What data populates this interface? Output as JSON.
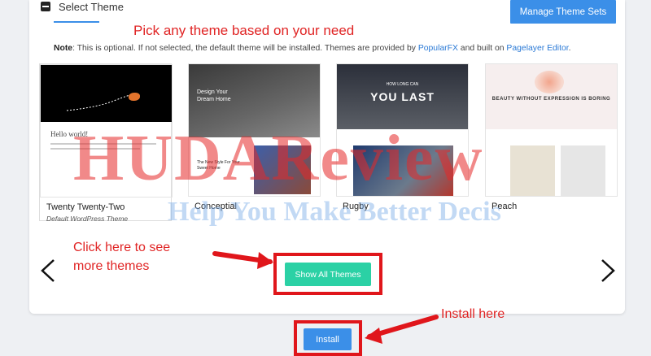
{
  "section": {
    "title": "Select Theme",
    "manage_button": "Manage Theme Sets"
  },
  "annotations": {
    "top": "Pick any theme based on your need",
    "more_line1": "Click here to see",
    "more_line2": "more themes",
    "install": "Install here"
  },
  "note": {
    "label": "Note",
    "text_before": ": This is optional. If not selected, the default theme will be installed. Themes are provided by ",
    "link1": "PopularFX",
    "text_middle": " and built on ",
    "link2": "Pagelayer Editor",
    "text_after": "."
  },
  "themes": [
    {
      "name": "Twenty Twenty-Two",
      "subtitle": "Default WordPress Theme"
    },
    {
      "name": "Conceptial",
      "subtitle": ""
    },
    {
      "name": "Rugby",
      "subtitle": ""
    },
    {
      "name": "Peach",
      "subtitle": ""
    }
  ],
  "thumbs": {
    "t1_hello": "Hello world!",
    "t2_title": "Design Your Dream Home",
    "t2_sub": "The New Style For Your Sweet Home",
    "t3_small": "HOW LONG CAN",
    "t3_big": "YOU LAST",
    "t4_text": "BEAUTY WITHOUT EXPRESSION IS BORING"
  },
  "buttons": {
    "show_all": "Show All Themes",
    "install": "Install"
  },
  "watermark": {
    "main": "HUDAReview",
    "tagline": "Help You Make Better Decis"
  },
  "colors": {
    "primary": "#3b8fe8",
    "accent_green": "#2bd1a5",
    "annotation_red": "#e0161b"
  }
}
